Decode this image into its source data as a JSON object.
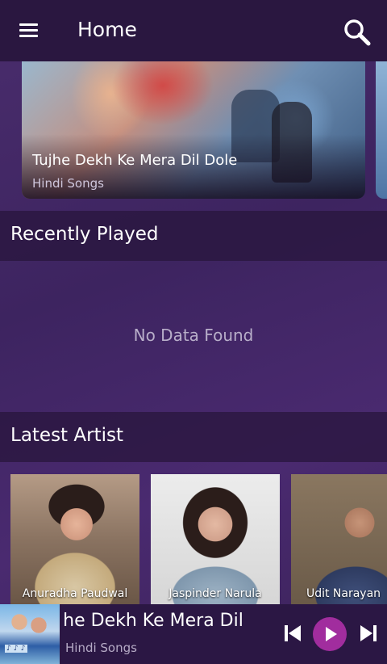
{
  "header": {
    "title": "Home",
    "menu_icon": "hamburger-menu-icon",
    "search_icon": "search-icon"
  },
  "banner": {
    "title": "Tujhe Dekh Ke Mera Dil Dole",
    "subtitle": "Hindi Songs"
  },
  "recently_played": {
    "heading": "Recently Played",
    "empty_message": "No Data Found"
  },
  "latest_artist": {
    "heading": "Latest Artist",
    "artists": [
      {
        "name": "Anuradha Paudwal"
      },
      {
        "name": "Jaspinder Narula"
      },
      {
        "name": "Udit Narayan"
      }
    ]
  },
  "player": {
    "title": "Tujhe Dekh Ke Mera Dil Dole",
    "subtitle": "Hindi Songs",
    "controls": [
      "previous-icon",
      "play-icon",
      "next-icon"
    ],
    "accent_color": "#a12d9e"
  },
  "colors": {
    "header_bg": "#2a1740",
    "player_bg": "#2b1744",
    "accent": "#a12d9e"
  }
}
